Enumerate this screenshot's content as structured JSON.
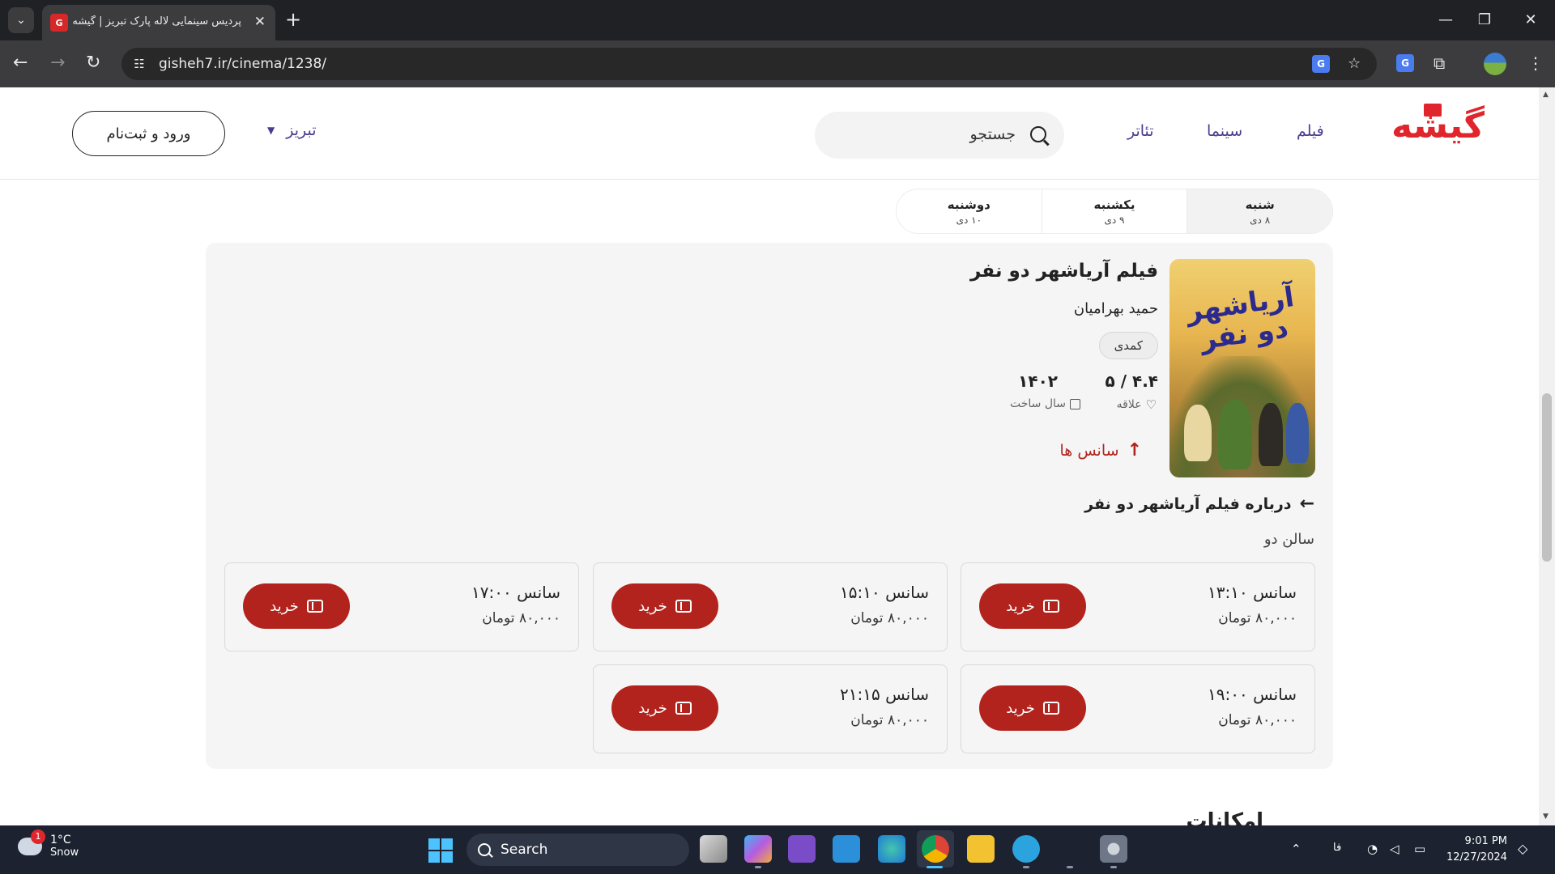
{
  "browser": {
    "tab_title": "پردیس سینمایی لاله پارک تبریز | گیشه",
    "tab_dropdown_glyph": "⌄",
    "url": "gisheh7.ir/cinema/1238/",
    "new_tab_glyph": "+",
    "close_glyph": "✕",
    "minimize_glyph": "—",
    "restore_glyph": "❐",
    "window_close_glyph": "✕"
  },
  "site": {
    "logo_text": "گیشه",
    "nav": [
      "فیلم",
      "سینما",
      "تئاتر"
    ],
    "search_placeholder": "جستجو",
    "city": "تبریز",
    "login_label": "ورود و ثبت‌نام"
  },
  "days": [
    {
      "name": "شنبه",
      "date": "۸ دی",
      "active": true
    },
    {
      "name": "یکشنبه",
      "date": "۹ دی",
      "active": false
    },
    {
      "name": "دوشنبه",
      "date": "۱۰ دی",
      "active": false
    }
  ],
  "movie": {
    "poster_title": "آریاشهر دو نفر",
    "title": "فیلم آریاشهر دو نفر",
    "director": "حمید بهرامیان",
    "genre": "کمدی",
    "rating": "۴.۴ / ۵",
    "rating_label": "علاقه",
    "year": "۱۴۰۲",
    "year_label": "سال ساخت",
    "sessions_link": "سانس ها",
    "about_link": "درباره فیلم آریاشهر دو نفر",
    "hall": "سالن دو"
  },
  "showtimes": [
    {
      "time": "سانس ۱۳:۱۰",
      "price": "۸۰,۰۰۰ تومان",
      "buy": "خرید"
    },
    {
      "time": "سانس ۱۵:۱۰",
      "price": "۸۰,۰۰۰ تومان",
      "buy": "خرید"
    },
    {
      "time": "سانس ۱۷:۰۰",
      "price": "۸۰,۰۰۰ تومان",
      "buy": "خرید"
    },
    {
      "time": "سانس ۱۹:۰۰",
      "price": "۸۰,۰۰۰ تومان",
      "buy": "خرید"
    },
    {
      "time": "سانس ۲۱:۱۵",
      "price": "۸۰,۰۰۰ تومان",
      "buy": "خرید"
    }
  ],
  "facilities_heading": "امکانات",
  "taskbar": {
    "weather_temp": "1°C",
    "weather_desc": "Snow",
    "weather_badge": "1",
    "search_label": "Search",
    "lang": "فا",
    "time": "9:01 PM",
    "date": "12/27/2024"
  },
  "colors": {
    "brand_red": "#e0262c",
    "buy_red": "#b3231d",
    "nav_purple": "#4a3b8f"
  }
}
